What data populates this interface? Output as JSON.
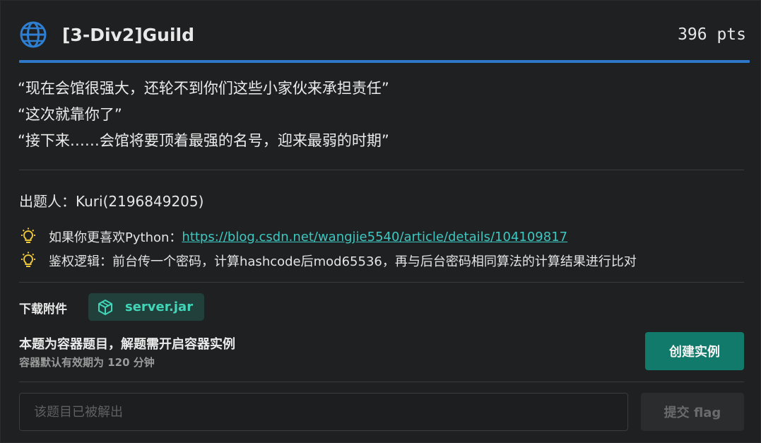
{
  "challenge": {
    "title": "[3-Div2]Guild",
    "points": "396 pts",
    "quotes": [
      "“现在会馆很强大，还轮不到你们这些小家伙来承担责任”",
      "“这次就靠你了”",
      "“接下来……会馆将要顶着最强的名号，迎来最弱的时期”"
    ],
    "author": "出题人：Kuri(2196849205)",
    "tips": [
      {
        "prefix": "如果你更喜欢Python：",
        "link": "https://blog.csdn.net/wangjie5540/article/details/104109817"
      },
      {
        "prefix": "鉴权逻辑：前台传一个密码，计算hashcode后mod65536，再与后台密码相同算法的计算结果进行比对",
        "link": ""
      }
    ]
  },
  "attachment": {
    "label": "下载附件",
    "filename": "server.jar"
  },
  "container": {
    "title": "本题为容器题目，解题需开启容器实例",
    "subtitle": "容器默认有效期为 120 分钟",
    "create_label": "创建实例"
  },
  "flag": {
    "placeholder": "该题目已被解出",
    "submit_label": "提交 flag"
  },
  "colors": {
    "accent": "#2d78c8",
    "link": "#3ec7c0",
    "primary_button": "#127a6a",
    "attachment": "#41d6b8",
    "bulb": "#f0c93a"
  },
  "icons": {
    "title": "globe-icon",
    "tip": "lightbulb-icon",
    "attachment": "package-icon"
  }
}
